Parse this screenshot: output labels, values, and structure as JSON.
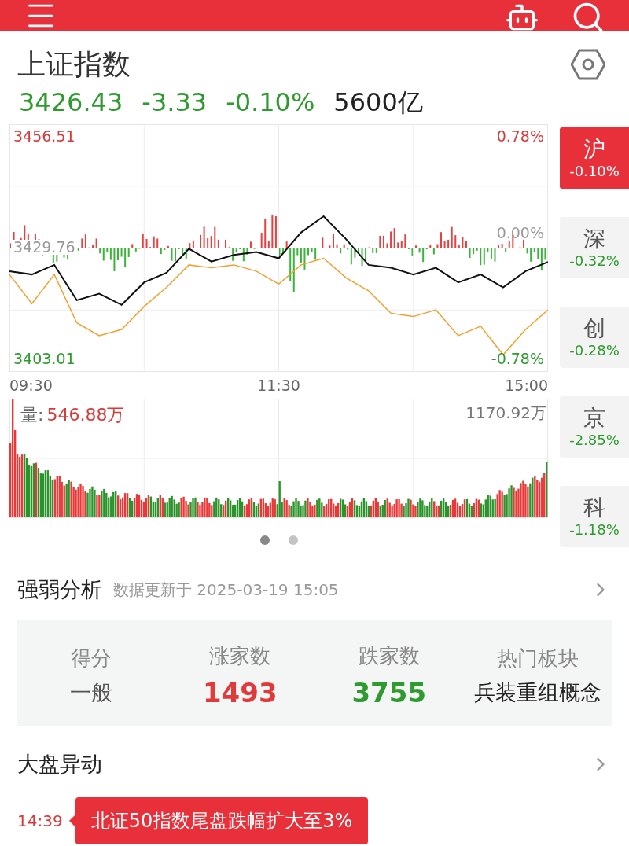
{
  "index": {
    "name": "上证指数",
    "price": "3426.43",
    "change": "-3.33",
    "change_pct": "-0.10%",
    "turnover": "5600亿"
  },
  "price_chart": {
    "chart_data": {
      "type": "line",
      "grid": true,
      "ylim": [
        3400.0,
        3459.5
      ],
      "series": [
        {
          "color": "#111111",
          "values": [
            3424.2,
            3423.4,
            3425.7,
            3417.2,
            3418.8,
            3416.1,
            3421.5,
            3423.8,
            3429.6,
            3426.5,
            3428.1,
            3428.8,
            3427.3,
            3433.5,
            3437.4,
            3431.9,
            3425.7,
            3425.0,
            3423.4,
            3425.0,
            3421.5,
            3423.4,
            3420.3,
            3424.2,
            3426.4
          ]
        },
        {
          "color": "#f0a030",
          "values": [
            3423.4,
            3416.4,
            3423.4,
            3411.8,
            3408.7,
            3410.2,
            3415.7,
            3420.3,
            3425.7,
            3425.0,
            3425.7,
            3424.2,
            3421.1,
            3425.7,
            3427.3,
            3422.6,
            3419.5,
            3414.1,
            3413.3,
            3414.9,
            3408.7,
            3411.0,
            3404.1,
            3410.2,
            3414.9
          ]
        }
      ],
      "yticks": [
        {
          "value": 3403.01,
          "label": "3403.01"
        },
        {
          "value": 3429.76,
          "label": "3429.76"
        },
        {
          "value": 3456.51,
          "label": "3456.51"
        }
      ]
    },
    "time_labels": [
      "09:30",
      "11:30",
      "15:00"
    ],
    "right_labels": [
      {
        "text": "0.78%",
        "color": "#d83a3a"
      },
      {
        "text": "0.00%",
        "color": "#999999"
      },
      {
        "text": "-0.78%",
        "color": "#2f9a2f"
      }
    ]
  },
  "volume": {
    "label": "量:",
    "value": "546.88万",
    "max": "1170.92万"
  },
  "pager": [
    {
      "selected": true
    },
    {
      "selected": false
    }
  ],
  "market_tabs": [
    {
      "label": "沪",
      "change": "-0.10%",
      "selected": true
    },
    {
      "label": "深",
      "change": "-0.32%",
      "selected": false
    },
    {
      "label": "创",
      "change": "-0.28%",
      "selected": false
    },
    {
      "label": "京",
      "change": "-2.85%",
      "selected": false
    },
    {
      "label": "科",
      "change": "-1.18%",
      "selected": false
    }
  ],
  "strength": {
    "title": "强弱分析",
    "updated": "数据更新于 2025-03-19 15:05",
    "stats": [
      {
        "label": "得分",
        "value": "一般",
        "color": "#555555"
      },
      {
        "label": "涨家数",
        "value": "1493",
        "color": "#e03a3a"
      },
      {
        "label": "跌家数",
        "value": "3755",
        "color": "#2f9a2f"
      },
      {
        "label": "热门板块",
        "value": "兵装重组概念",
        "color": "#222222"
      }
    ]
  },
  "movements": {
    "title": "大盘异动",
    "items": [
      {
        "time": "14:39",
        "text": "北证50指数尾盘跌幅扩大至3%"
      }
    ]
  }
}
